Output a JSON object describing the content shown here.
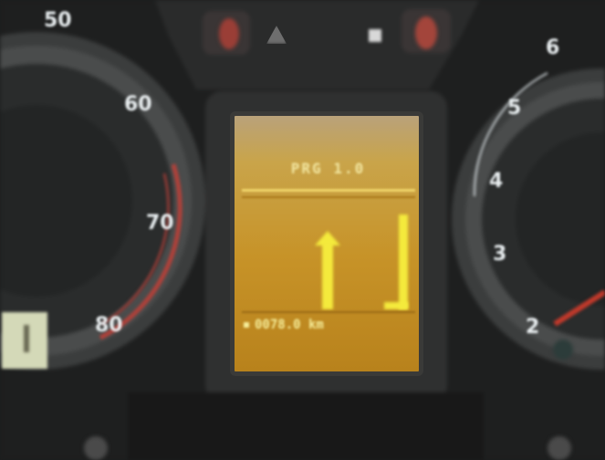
{
  "speedometer": {
    "labels": [
      "50",
      "60",
      "70",
      "80"
    ]
  },
  "tachometer": {
    "labels": [
      "6",
      "5",
      "4",
      "3",
      "2"
    ]
  },
  "display": {
    "header": "PRG 1.0",
    "odometer": "0078.0 km",
    "trip": ""
  },
  "colors": {
    "display_amber": "#c79328",
    "display_yellow": "#f4ea3c",
    "needle_red": "#c0392b",
    "dial_face": "#2c2e2e"
  }
}
